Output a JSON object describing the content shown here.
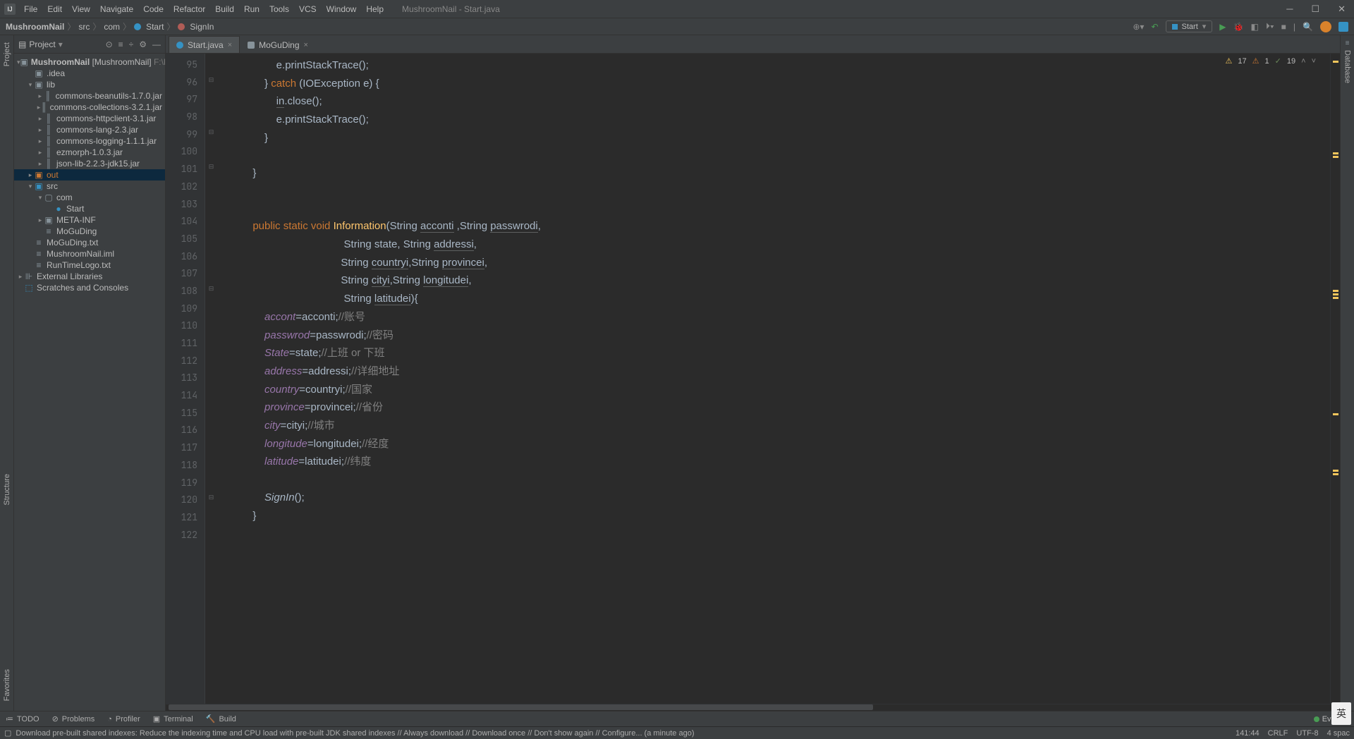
{
  "window": {
    "title": "MushroomNail - Start.java"
  },
  "menus": [
    "File",
    "Edit",
    "View",
    "Navigate",
    "Code",
    "Refactor",
    "Build",
    "Run",
    "Tools",
    "VCS",
    "Window",
    "Help"
  ],
  "breadcrumb": {
    "project": "MushroomNail",
    "parts": [
      "src",
      "com",
      "Start",
      "SignIn"
    ]
  },
  "runConfig": {
    "label": "Start"
  },
  "projectTool": {
    "title": "Project"
  },
  "tree": {
    "root": {
      "name": "MushroomNail",
      "module": "[MushroomNail]",
      "path": "F:\\Po"
    },
    "idea": ".idea",
    "lib": "lib",
    "libs": [
      "commons-beanutils-1.7.0.jar",
      "commons-collections-3.2.1.jar",
      "commons-httpclient-3.1.jar",
      "commons-lang-2.3.jar",
      "commons-logging-1.1.1.jar",
      "ezmorph-1.0.3.jar",
      "json-lib-2.2.3-jdk15.jar"
    ],
    "out": "out",
    "src": "src",
    "com": "com",
    "start": "Start",
    "meta": "META-INF",
    "moguding": "MoGuDing",
    "files": [
      "MoGuDing.txt",
      "MushroomNail.iml",
      "RunTimeLogo.txt"
    ],
    "ext": "External Libraries",
    "scratch": "Scratches and Consoles"
  },
  "tabs": [
    {
      "name": "Start.java",
      "active": true,
      "color": "#3592c4"
    },
    {
      "name": "MoGuDing",
      "active": false,
      "color": "#87939a"
    }
  ],
  "inspections": {
    "warn": "17",
    "weak": "1",
    "typo": "19"
  },
  "gutter": {
    "start": 95,
    "end": 122
  },
  "bottom": {
    "todo": "TODO",
    "problems": "Problems",
    "profiler": "Profiler",
    "terminal": "Terminal",
    "build": "Build",
    "event": "Event L"
  },
  "status": {
    "msg": "Download pre-built shared indexes: Reduce the indexing time and CPU load with pre-built JDK shared indexes // Always download // Download once // Don't show again // Configure... (a minute ago)",
    "pos": "141:44",
    "sep": "CRLF",
    "enc": "UTF-8",
    "indent": "4 spac"
  },
  "ime": "英",
  "rightRail": "Database",
  "leftRail": {
    "project": "Project",
    "structure": "Structure",
    "favorites": "Favorites"
  },
  "code": {
    "l95": "                e.printStackTrace();",
    "l96a": "            } ",
    "l96b": "catch",
    "l96c": " (IOException e) {",
    "l97a": "                ",
    "l97b": "in",
    "l97c": ".close();",
    "l98": "                e.printStackTrace();",
    "l99": "            }",
    "l101": "        }",
    "l104a": "        ",
    "l104b": "public static void ",
    "l104c": "Information",
    "l104d": "(String ",
    "l104e": "acconti",
    "l104f": " ,String ",
    "l104g": "passwrodi",
    "l104h": ",",
    "l105a": "                                       String state, String ",
    "l105b": "addressi",
    "l105c": ",",
    "l106a": "                                      String ",
    "l106b": "countryi",
    "l106c": ",String ",
    "l106d": "provincei",
    "l106e": ",",
    "l107a": "                                      String ",
    "l107b": "cityi",
    "l107c": ",String ",
    "l107d": "longitudei",
    "l107e": ",",
    "l108a": "                                       String ",
    "l108b": "latitudei",
    "l108c": "){",
    "l109a": "            ",
    "l109b": "accont",
    "l109c": "=acconti;",
    "l109d": "//账号",
    "l110a": "            ",
    "l110b": "passwrod",
    "l110c": "=passwrodi;",
    "l110d": "//密码",
    "l111a": "            ",
    "l111b": "State",
    "l111c": "=state;",
    "l111d": "//上班 or 下班",
    "l112a": "            ",
    "l112b": "address",
    "l112c": "=addressi;",
    "l112d": "//详细地址",
    "l113a": "            ",
    "l113b": "country",
    "l113c": "=countryi;",
    "l113d": "//国家",
    "l114a": "            ",
    "l114b": "province",
    "l114c": "=provincei;",
    "l114d": "//省份",
    "l115a": "            ",
    "l115b": "city",
    "l115c": "=cityi;",
    "l115d": "//城市",
    "l116a": "            ",
    "l116b": "longitude",
    "l116c": "=longitudei;",
    "l116d": "//经度",
    "l117a": "            ",
    "l117b": "latitude",
    "l117c": "=latitudei;",
    "l117d": "//纬度",
    "l119a": "            ",
    "l119b": "SignIn",
    "l119c": "();",
    "l120": "        }"
  }
}
